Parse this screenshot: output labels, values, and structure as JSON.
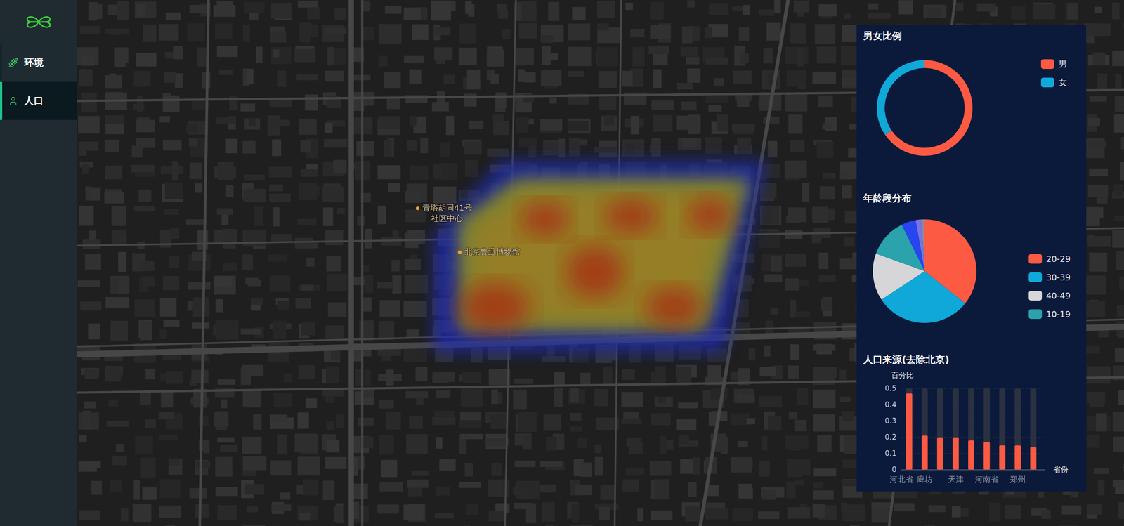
{
  "sidebar": {
    "items": [
      {
        "label": "环境",
        "selected": false
      },
      {
        "label": "人口",
        "selected": true
      }
    ]
  },
  "map": {
    "pins": [
      {
        "lines": [
          "青塔胡同41号",
          "社区中心"
        ]
      },
      {
        "lines": [
          "北京鲁迅博物馆"
        ]
      }
    ]
  },
  "panel": {
    "gender": {
      "title": "男女比例",
      "series": [
        {
          "label": "男",
          "value": 0.655,
          "color": "#fd5a43"
        },
        {
          "label": "女",
          "value": 0.345,
          "color": "#0fa8d8"
        }
      ]
    },
    "age": {
      "title": "年龄段分布",
      "slices": [
        {
          "label": "20-29",
          "value": 0.357,
          "color": "#fd5a43"
        },
        {
          "label": "30-39",
          "value": 0.3,
          "color": "#0fa8d8"
        },
        {
          "label": "40-49",
          "value": 0.148,
          "color": "#d6d6d8"
        },
        {
          "label": "10-19",
          "value": 0.122,
          "color": "#2aa3ad"
        },
        {
          "value": 0.045,
          "color": "#2745f0"
        },
        {
          "value": 0.017,
          "color": "#7b73e0"
        },
        {
          "value": 0.011,
          "color": "#8a8aa0"
        }
      ]
    },
    "origin": {
      "title": "人口来源(去除北京)",
      "y_axis_name": "百分比",
      "x_axis_name": "省份",
      "y_ticks": [
        "0",
        "0.1",
        "0.2",
        "0.3",
        "0.4",
        "0.5"
      ],
      "y_max": 0.5,
      "bars": [
        {
          "label": "河北省",
          "value": 0.47
        },
        {
          "label": "廊坊",
          "value": 0.21
        },
        {
          "label": "",
          "value": 0.2
        },
        {
          "label": "天津",
          "value": 0.2
        },
        {
          "label": "",
          "value": 0.18
        },
        {
          "label": "河南省",
          "value": 0.17
        },
        {
          "label": "",
          "value": 0.15
        },
        {
          "label": "郑州",
          "value": 0.15
        },
        {
          "label": "",
          "value": 0.14
        }
      ]
    }
  }
}
